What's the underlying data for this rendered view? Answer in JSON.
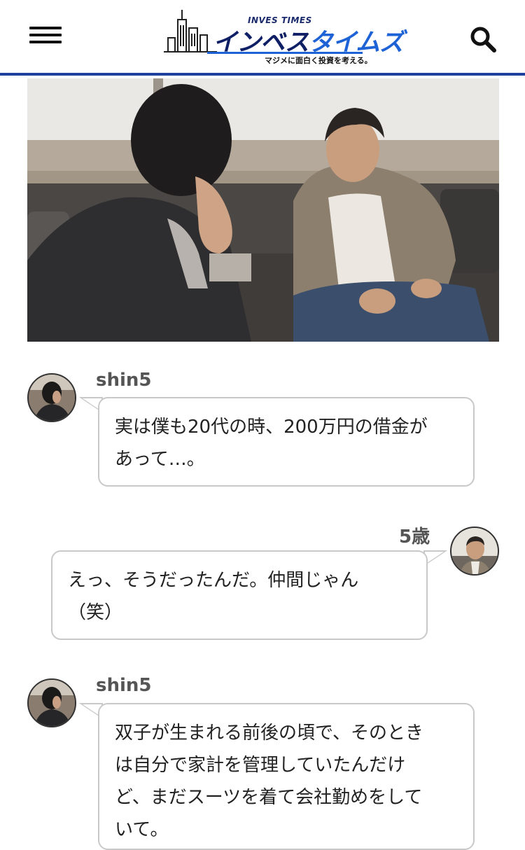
{
  "header": {
    "logo_en": "INVES TIMES",
    "logo_ja_main": "インベス",
    "logo_ja_accent": "タイムズ",
    "logo_tagline": "マジメに面白く投資を考える。",
    "menu_icon": "hamburger-menu-icon",
    "search_icon": "search-icon",
    "accent_color": "#1f3f9e"
  },
  "hero": {
    "image": "photo-two-men-talking-on-sofa"
  },
  "chat": [
    {
      "speaker": "shin5",
      "side": "left",
      "text_lines": [
        "実は僕も20代の時、200万円の借金が",
        "あって…。"
      ]
    },
    {
      "speaker": "5歳",
      "side": "right",
      "text_lines": [
        "えっ、そうだったんだ。仲間じゃん",
        "（笑）"
      ]
    },
    {
      "speaker": "shin5",
      "side": "left",
      "text_lines": [
        "双子が生まれる前後の頃で、そのとき",
        "は自分で家計を管理していたんだけ",
        "ど、まだスーツを着て会社勤めをして",
        "いて。"
      ]
    }
  ]
}
